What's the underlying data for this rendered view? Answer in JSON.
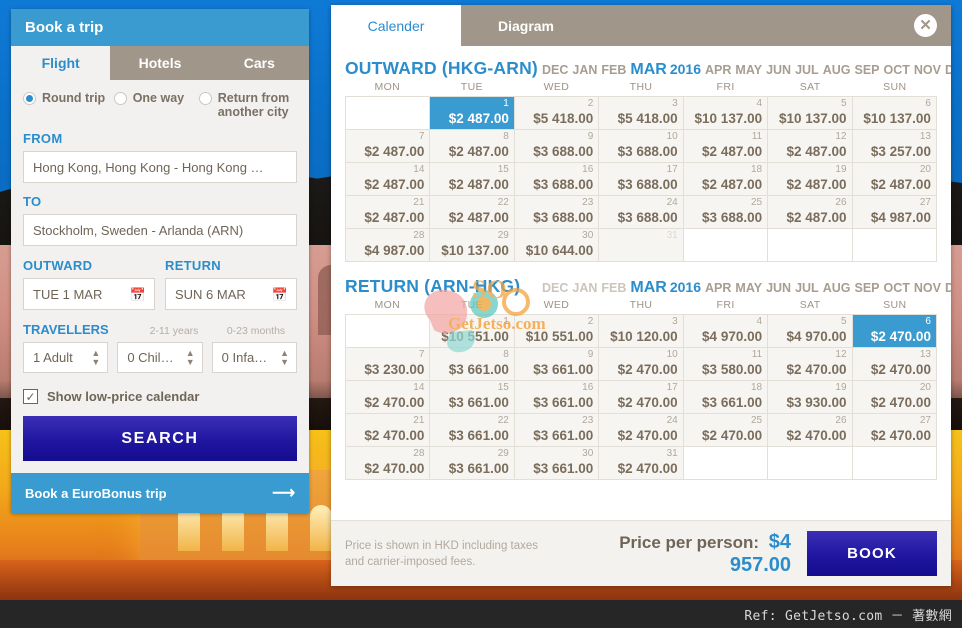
{
  "booking": {
    "title": "Book a trip",
    "tabs": [
      {
        "label": "Flight",
        "active": true
      },
      {
        "label": "Hotels",
        "active": false
      },
      {
        "label": "Cars",
        "active": false
      }
    ],
    "trip_types": [
      {
        "label": "Round trip",
        "selected": true
      },
      {
        "label": "One way",
        "selected": false
      },
      {
        "label": "Return from another city",
        "selected": false
      }
    ],
    "from_label": "FROM",
    "from_value": "Hong Kong, Hong Kong - Hong Kong …",
    "to_label": "TO",
    "to_value": "Stockholm, Sweden - Arlanda (ARN)",
    "outward_label": "OUTWARD",
    "outward_value": "TUE 1 MAR",
    "return_label": "RETURN",
    "return_value": "SUN 6 MAR",
    "travellers_label": "TRAVELLERS",
    "children_hint": "2-11 years",
    "infants_hint": "0-23 months",
    "adults_value": "1 Adult",
    "children_value": "0 Chil…",
    "infants_value": "0 Infa…",
    "low_price_label": "Show low-price calendar",
    "low_price_checked": true,
    "search_label": "SEARCH",
    "eurobonus_label": "Book a EuroBonus trip"
  },
  "calendar_panel": {
    "tabs": [
      {
        "label": "Calender",
        "active": true
      },
      {
        "label": "Diagram",
        "active": false
      }
    ],
    "close_label": "✕",
    "footer": {
      "note": "Price is shown in HKD including taxes and carrier-imposed fees.",
      "price_label": "Price per person:",
      "price_value": "$4 957.00",
      "book_label": "BOOK"
    },
    "weekdays": [
      "MON",
      "TUE",
      "WED",
      "THU",
      "FRI",
      "SAT",
      "SUN"
    ],
    "outward": {
      "title": "OUTWARD (HKG-ARN)",
      "months": [
        "DEC",
        "JAN",
        "FEB",
        "MAR",
        "APR",
        "MAY",
        "JUN",
        "JUL",
        "AUG",
        "SEP",
        "OCT",
        "NOV",
        "DEC"
      ],
      "current_month": "MAR",
      "year": "2016",
      "lead_blanks": 1,
      "days": [
        {
          "day": 1,
          "price": "$2 487.00",
          "selected": true
        },
        {
          "day": 2,
          "price": "$5 418.00"
        },
        {
          "day": 3,
          "price": "$5 418.00"
        },
        {
          "day": 4,
          "price": "$10 137.00"
        },
        {
          "day": 5,
          "price": "$10 137.00"
        },
        {
          "day": 6,
          "price": "$10 137.00"
        },
        {
          "day": 7,
          "price": "$2 487.00"
        },
        {
          "day": 8,
          "price": "$2 487.00"
        },
        {
          "day": 9,
          "price": "$3 688.00"
        },
        {
          "day": 10,
          "price": "$3 688.00"
        },
        {
          "day": 11,
          "price": "$2 487.00"
        },
        {
          "day": 12,
          "price": "$2 487.00"
        },
        {
          "day": 13,
          "price": "$3 257.00"
        },
        {
          "day": 14,
          "price": "$2 487.00"
        },
        {
          "day": 15,
          "price": "$2 487.00"
        },
        {
          "day": 16,
          "price": "$3 688.00"
        },
        {
          "day": 17,
          "price": "$3 688.00"
        },
        {
          "day": 18,
          "price": "$2 487.00"
        },
        {
          "day": 19,
          "price": "$2 487.00"
        },
        {
          "day": 20,
          "price": "$2 487.00"
        },
        {
          "day": 21,
          "price": "$2 487.00"
        },
        {
          "day": 22,
          "price": "$2 487.00"
        },
        {
          "day": 23,
          "price": "$3 688.00"
        },
        {
          "day": 24,
          "price": "$3 688.00"
        },
        {
          "day": 25,
          "price": "$3 688.00"
        },
        {
          "day": 26,
          "price": "$2 487.00"
        },
        {
          "day": 27,
          "price": "$4 987.00"
        },
        {
          "day": 28,
          "price": "$4 987.00"
        },
        {
          "day": 29,
          "price": "$10 137.00"
        },
        {
          "day": 30,
          "price": "$10 644.00"
        },
        {
          "day": 31,
          "price": ""
        }
      ]
    },
    "return": {
      "title": "RETURN (ARN-HKG)",
      "months": [
        "DEC",
        "JAN",
        "FEB",
        "MAR",
        "APR",
        "MAY",
        "JUN",
        "JUL",
        "AUG",
        "SEP",
        "OCT",
        "NOV",
        "DEC"
      ],
      "current_month": "MAR",
      "year": "2016",
      "dim_months": [
        "DEC",
        "JAN",
        "FEB"
      ],
      "lead_blanks": 1,
      "days": [
        {
          "day": 1,
          "price": "$10 551.00"
        },
        {
          "day": 2,
          "price": "$10 551.00"
        },
        {
          "day": 3,
          "price": "$10 120.00"
        },
        {
          "day": 4,
          "price": "$4 970.00"
        },
        {
          "day": 5,
          "price": "$4 970.00"
        },
        {
          "day": 6,
          "price": "$2 470.00",
          "selected": true
        },
        {
          "day": 7,
          "price": "$3 230.00"
        },
        {
          "day": 8,
          "price": "$3 661.00"
        },
        {
          "day": 9,
          "price": "$3 661.00"
        },
        {
          "day": 10,
          "price": "$2 470.00"
        },
        {
          "day": 11,
          "price": "$3 580.00"
        },
        {
          "day": 12,
          "price": "$2 470.00"
        },
        {
          "day": 13,
          "price": "$2 470.00"
        },
        {
          "day": 14,
          "price": "$2 470.00"
        },
        {
          "day": 15,
          "price": "$3 661.00"
        },
        {
          "day": 16,
          "price": "$3 661.00"
        },
        {
          "day": 17,
          "price": "$2 470.00"
        },
        {
          "day": 18,
          "price": "$3 661.00"
        },
        {
          "day": 19,
          "price": "$3 930.00"
        },
        {
          "day": 20,
          "price": "$2 470.00"
        },
        {
          "day": 21,
          "price": "$2 470.00"
        },
        {
          "day": 22,
          "price": "$3 661.00"
        },
        {
          "day": 23,
          "price": "$3 661.00"
        },
        {
          "day": 24,
          "price": "$2 470.00"
        },
        {
          "day": 25,
          "price": "$2 470.00"
        },
        {
          "day": 26,
          "price": "$2 470.00"
        },
        {
          "day": 27,
          "price": "$2 470.00"
        },
        {
          "day": 28,
          "price": "$2 470.00"
        },
        {
          "day": 29,
          "price": "$3 661.00"
        },
        {
          "day": 30,
          "price": "$3 661.00"
        },
        {
          "day": 31,
          "price": "$2 470.00"
        }
      ]
    }
  },
  "watermark": {
    "text": "GetJetso.com"
  },
  "ref_bar": {
    "text": "Ref: GetJetso.com － 著數網"
  },
  "colors": {
    "brand_blue": "#2b8dcc",
    "header_blue": "#3a9bd0",
    "tab_taupe": "#a1968a",
    "button_indigo": "#2016a0",
    "price_text": "#7a6d5c",
    "panel_bg": "#f2f1ef"
  }
}
